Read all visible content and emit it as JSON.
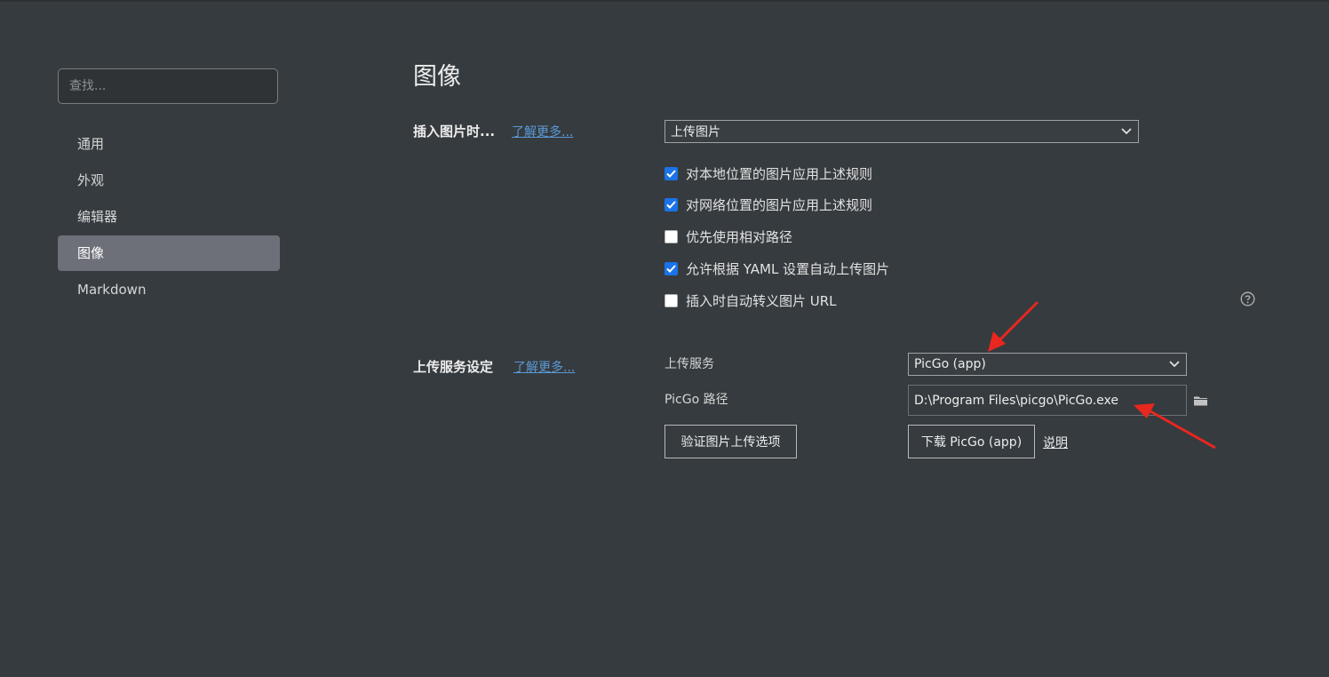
{
  "sidebar": {
    "search_placeholder": "查找...",
    "items": [
      {
        "label": "通用"
      },
      {
        "label": "外观"
      },
      {
        "label": "编辑器"
      },
      {
        "label": "图像",
        "active": true
      },
      {
        "label": "Markdown"
      }
    ]
  },
  "main": {
    "title": "图像",
    "insert_section": {
      "label": "插入图片时...",
      "learn_more": "了解更多...",
      "select_value": "上传图片",
      "options": [
        {
          "label": "对本地位置的图片应用上述规则",
          "checked": true
        },
        {
          "label": "对网络位置的图片应用上述规则",
          "checked": true
        },
        {
          "label": "优先使用相对路径",
          "checked": false
        },
        {
          "label": "允许根据 YAML 设置自动上传图片",
          "checked": true
        },
        {
          "label": "插入时自动转义图片 URL",
          "checked": false
        }
      ]
    },
    "upload_section": {
      "label": "上传服务设定",
      "learn_more": "了解更多...",
      "service_label": "上传服务",
      "service_value": "PicGo (app)",
      "path_label": "PicGo 路径",
      "path_value": "D:\\Program Files\\picgo\\PicGo.exe",
      "verify_button": "验证图片上传选项",
      "download_button": "下载 PicGo (app)",
      "help_link": "说明"
    }
  },
  "colors": {
    "background": "#363b3f",
    "active_item": "#6e7079",
    "checkbox_on": "#1a73e8",
    "link": "#5b9ad6",
    "annotation_arrow": "#e8271f"
  }
}
